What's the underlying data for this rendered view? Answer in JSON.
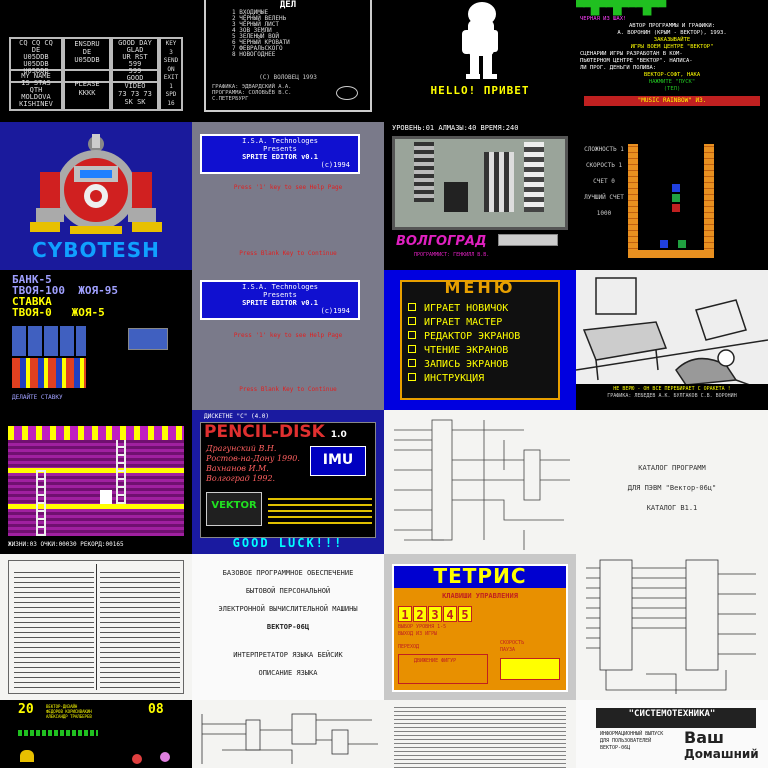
{
  "colors": {
    "blue": "#1010c8",
    "yellow": "#ffff00",
    "cyan": "#00ffff",
    "white": "#ffffff",
    "black": "#000000",
    "red": "#e02020",
    "magenta": "#c020c0",
    "green": "#20c020",
    "gray": "#808080",
    "orange": "#e8a000"
  },
  "t1": {
    "c1": [
      "CQ CQ CQ",
      "DE",
      "U05DDB",
      "U05DDB",
      "U05DDB"
    ],
    "c2": [
      "ENSDRU",
      "DE",
      "U05DDB"
    ],
    "c3": [
      "GOOD DAY",
      "GLAD",
      "UR RST",
      "599",
      "599"
    ],
    "c4": [
      "KEY",
      "3",
      "SEND",
      "ON",
      "EXIT",
      "1",
      "SPD",
      "16"
    ],
    "c5": [
      "MY NAME",
      "IS STAS",
      "QTH",
      "MOLDOVA",
      "KISHINEV"
    ],
    "c6": [
      "PLEASE",
      "KKKK"
    ],
    "c7": [
      "GOOD",
      "VIDEO",
      "73 73 73",
      "SK SK"
    ]
  },
  "t2": {
    "title": "ДЕЛ",
    "menu": [
      "1 ВХОДИМЫЕ",
      "2 ЧЁРНЫЙ ВЕЛЕНЬ",
      "3 ЧЁРНЫЙ ЛИСТ",
      "4 ЗОВ ЗЕМЛИ",
      "5 ЗЕЛЕНЫЙ ВОЙ",
      "6 ЧЕРНЫЙ КРОВАТИ",
      "7 ФЕВРАЛЬСКОГО",
      "8 НОВОГОДНЕЕ"
    ],
    "copy": "(C) ВОЛОВЕЦ 1993",
    "credits": [
      "ГРАФИКА: ЭДВАРДСКИЙ А.А.",
      "ПРОГРАММА: СОЛОВЬЁВ В.С.",
      "С.ПЕТЕРБУРГ"
    ]
  },
  "t3": {
    "text": "HELLO! ПРИВЕТ"
  },
  "t4": {
    "lines": [
      "ЧЕРНАЯ ИЗ ШАХ!",
      "АВТОР ПРОГРАММЫ И ГРАФИКИ:",
      "А. ВОРОНИН (КРЫМ - ВЕКТОР), 1993.",
      "ЗАКАЗЫВАЙТЕ",
      "ИГРЫ ВОЕМ ЦЕНТРЕ \"ВЕКТОР\"",
      "СЦЕНАРИИ ИГРЫ РАЗРАБОТАН В КОМ-",
      "ПЬЮТЕРНОМ ЦЕНТРЕ \"ВЕКТОР\". НАПИСА-",
      "ЛИ ПРОГ. ДЕНЬГИ ПОЛИВА:",
      "ВЕКТОР-СОФТ, НАКА",
      "НАЖМИТЕ \"ПУСК\"",
      "(ТЕЛ)"
    ],
    "footer": "\"MUSIC RAINBOW\" ИЗ."
  },
  "t5": {
    "text": "CYBOTESH"
  },
  "t6": {
    "header": [
      "I.S.A. Technologes",
      "Presents",
      "SPRITE EDITOR v0.1",
      "(c)1994"
    ],
    "mid": "Press '1' key to see Help Page",
    "bottom": "Press Blank Key to Continue"
  },
  "t7": {
    "status": "УРОВЕНЬ:01 АЛМАЗЫ:40 ВРЕМЯ:240",
    "logo": "ВОЛГОГРАД",
    "credit": "ПРОГРАММИСТ: ГЕНКИЛЛ В.В."
  },
  "t8": {
    "labels": [
      "СЛОЖНОСТЬ 1",
      "СКОРОСТЬ 1",
      "СЧЕТ 0",
      "ЛУЧШИЙ СЧЕТ 1000"
    ]
  },
  "t9": {
    "lines": [
      "БАНК-5",
      "ТВОЯ-100",
      "ЖОЯ-95",
      "СТАВКА",
      "ТВОЯ-0",
      "ЖОЯ-5"
    ],
    "footer": "ДЕЛАЙТЕ СТАВКУ"
  },
  "t10": {
    "header": [
      "I.S.A. Technologes",
      "Presents",
      "SPRITE EDITOR v0.1",
      "(c)1994"
    ],
    "mid": "Press '1' key to see Help Page",
    "bottom": "Press Blank Key to Continue"
  },
  "t11": {
    "title": "МЕНЮ",
    "items": [
      "ИГРАЕТ НОВИЧОК",
      "ИГРАЕТ МАСТЕР",
      "РЕДАКТОР ЭКРАНОВ",
      "ЧТЕНИЕ ЭКРАНОВ",
      "ЗАПИСЬ ЭКРАНОВ",
      "ИНСТРУКЦИЯ"
    ]
  },
  "t12": {
    "caption": [
      "НЕ ВЕРЮ - ОН ВСЕ ПЕРЕБИРАЕТ С ОРАКЕТА !",
      "ГРАФИКА: ЛЕБЕДЕВ А.К.  БУЛГАКОВ С.В. ВОРОНИН"
    ]
  },
  "t13": {
    "status": "ЖИЗНИ:03 ОЧКИ:00030 РЕКОРД:00165"
  },
  "t14": {
    "top": "ДИСКЕТНЕ \"C\" (4.0)",
    "title": "PENCIL-DISK",
    "ver": "1.0",
    "credits": [
      "Драгунский В.Н.",
      "Ростов-на-Дону 1990.",
      "Вахнанов И.М.",
      "Волгоград 1992."
    ],
    "imu": "IMU",
    "vector": "VEKTOR",
    "luck": "GOOD LUCK!!!"
  },
  "t16": {
    "lines": [
      "КАТАЛОГ ПРОГРАММ",
      "ДЛЯ ПЭВМ \"Вектор-06ц\"",
      "КАТАЛОГ В1.1"
    ]
  },
  "t18": {
    "lines": [
      "БАЗОВОЕ ПРОГРАММНОЕ ОБЕСПЕЧЕНИЕ",
      "БЫТОВОЙ ПЕРСОНАЛЬНОЙ",
      "ЭЛЕКТРОННОЙ ВЫЧИСЛИТЕЛЬНОЙ МАШИНЫ",
      "ВЕКТОР-06Ц",
      "ИНТЕРПРЕТАТОР ЯЗЫКА БЕЙСИК",
      "ОПИСАНИЕ ЯЗЫКА"
    ]
  },
  "t19": {
    "title": "ТЕТРИС",
    "sub": "КЛАВИШИ УПРАВЛЕНИЯ",
    "digits": [
      "1",
      "2",
      "3",
      "4",
      "5"
    ],
    "labels": [
      "ВЫБОР УРОВНЯ 1-5",
      "ВЫХОД ИЗ ИГРЫ",
      "ПЕРЕХОД",
      "СКОРОСТЬ",
      "ПАУЗА",
      "ДВИЖЕНИЕ ФИГУР"
    ]
  },
  "t21": {
    "top": "20",
    "year": "08",
    "text": [
      "ВЕКТОР-ДИЗАЙН",
      "ФЕДОРОВ КОРИСИВАКИН",
      "АЛЕКСАНДР ТРАЛБЕРЕВ"
    ]
  },
  "t24": {
    "lines": [
      "\"СИСТЕМОТЕХНИКА\"",
      "ИНФОРМАЦИОННЫЙ ВЫПУСК",
      "ДЛЯ ПОЛЬЗОВАТЕЛЕЙ",
      "Ваш",
      "Домашний",
      "ВЕКТОР-06Ц"
    ]
  }
}
